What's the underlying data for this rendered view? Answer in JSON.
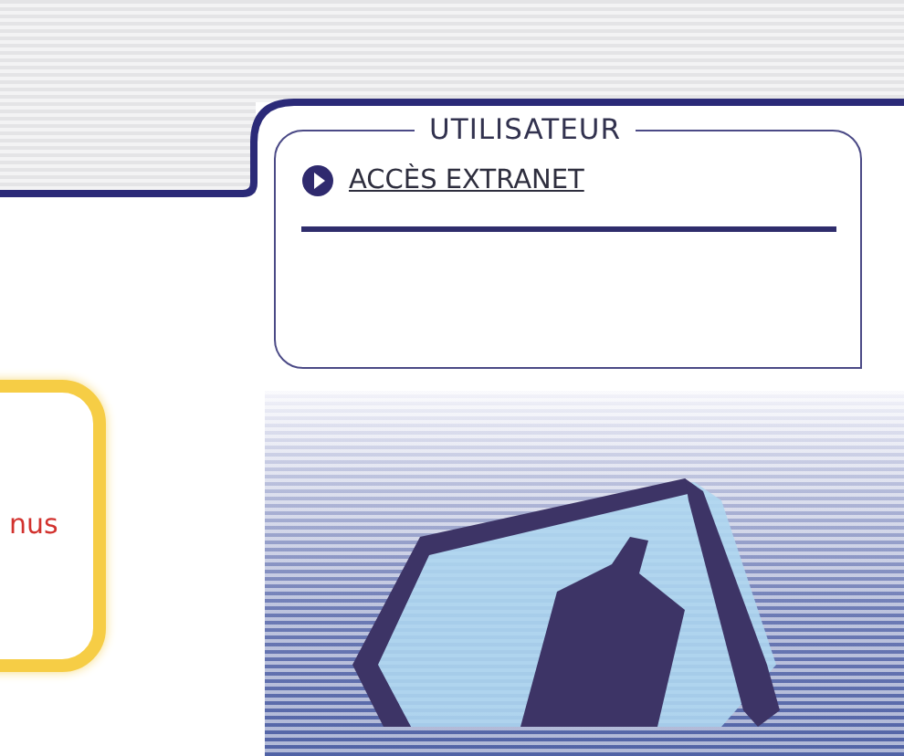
{
  "side_card": {
    "text": "nus"
  },
  "user_panel": {
    "title": "UTILISATEUR",
    "links": [
      {
        "label": "ACCÈS EXTRANET"
      }
    ]
  }
}
